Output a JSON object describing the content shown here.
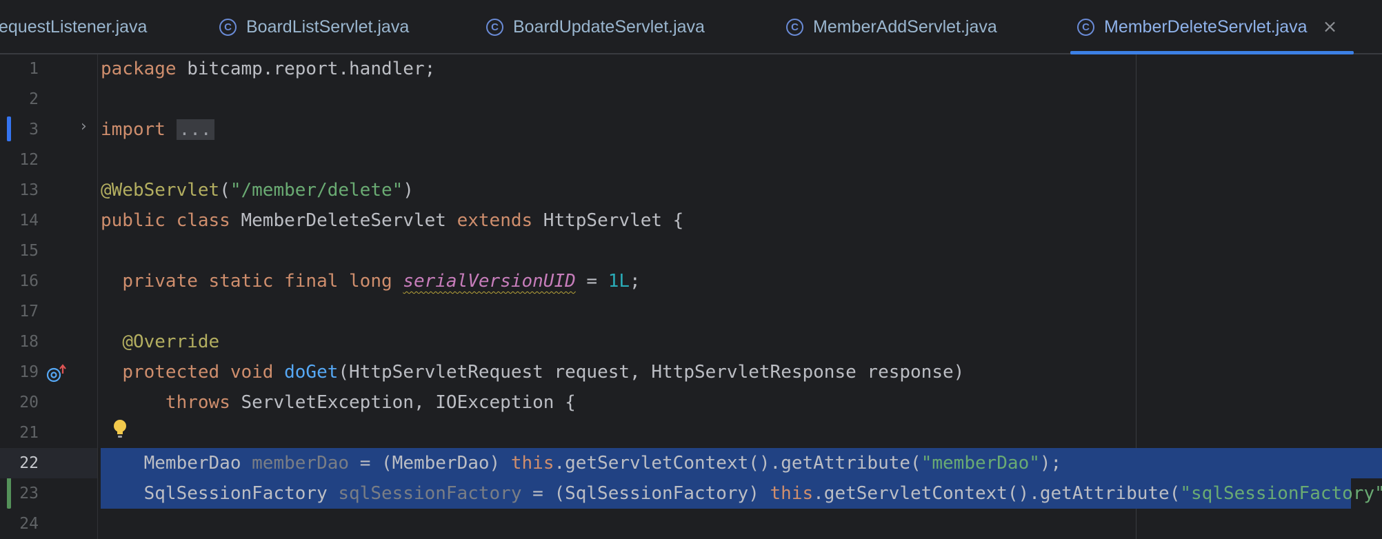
{
  "tabs": [
    {
      "label": "equestListener.java",
      "active": false
    },
    {
      "label": "BoardListServlet.java",
      "active": false
    },
    {
      "label": "BoardUpdateServlet.java",
      "active": false
    },
    {
      "label": "MemberAddServlet.java",
      "active": false
    },
    {
      "label": "MemberDeleteServlet.java",
      "active": true
    }
  ],
  "tab_icon_glyph": "C",
  "tab_close_glyph": "×",
  "colors": {
    "background": "#1e1f22",
    "selection": "#214283",
    "keyword": "#cf8e6d",
    "string": "#6aab73",
    "annotation": "#b3ae60",
    "number": "#2aacb8",
    "method": "#56a8f5",
    "constant": "#c77dbb",
    "active_tab_underline": "#3c80e6"
  },
  "editor": {
    "current_line": "22",
    "lines": [
      {
        "num": "1",
        "tokens": [
          [
            "kw",
            "package"
          ],
          [
            "txt",
            " bitcamp.report.handler;"
          ]
        ]
      },
      {
        "num": "2",
        "tokens": []
      },
      {
        "num": "3",
        "tokens": [
          [
            "kw",
            "import"
          ],
          [
            "txt",
            " "
          ],
          [
            "fold",
            "..."
          ]
        ]
      },
      {
        "num": "12",
        "tokens": []
      },
      {
        "num": "13",
        "tokens": [
          [
            "ann",
            "@WebServlet"
          ],
          [
            "txt",
            "("
          ],
          [
            "str",
            "\"/member/delete\""
          ],
          [
            "txt",
            ")"
          ]
        ]
      },
      {
        "num": "14",
        "tokens": [
          [
            "kw",
            "public class"
          ],
          [
            "txt",
            " MemberDeleteServlet "
          ],
          [
            "kw",
            "extends"
          ],
          [
            "txt",
            " HttpServlet {"
          ]
        ]
      },
      {
        "num": "15",
        "tokens": []
      },
      {
        "num": "16",
        "tokens": [
          [
            "txt",
            "  "
          ],
          [
            "kw",
            "private static final long"
          ],
          [
            "txt",
            " "
          ],
          [
            "const",
            "serialVersionUID"
          ],
          [
            "txt",
            " = "
          ],
          [
            "num",
            "1L"
          ],
          [
            "txt",
            ";"
          ]
        ]
      },
      {
        "num": "17",
        "tokens": []
      },
      {
        "num": "18",
        "tokens": [
          [
            "txt",
            "  "
          ],
          [
            "ann",
            "@Override"
          ]
        ]
      },
      {
        "num": "19",
        "tokens": [
          [
            "txt",
            "  "
          ],
          [
            "kw",
            "protected void"
          ],
          [
            "txt",
            " "
          ],
          [
            "fn",
            "doGet"
          ],
          [
            "txt",
            "(HttpServletRequest request, HttpServletResponse response)"
          ]
        ]
      },
      {
        "num": "20",
        "tokens": [
          [
            "txt",
            "      "
          ],
          [
            "kw",
            "throws"
          ],
          [
            "txt",
            " ServletException, IOException {"
          ]
        ]
      },
      {
        "num": "21",
        "tokens": []
      },
      {
        "num": "22",
        "tokens": [
          [
            "txt",
            "    MemberDao "
          ],
          [
            "unused",
            "memberDao"
          ],
          [
            "txt",
            " = (MemberDao) "
          ],
          [
            "kw",
            "this"
          ],
          [
            "txt",
            ".getServletContext().getAttribute("
          ],
          [
            "str",
            "\"memberDao\""
          ],
          [
            "txt",
            ");"
          ]
        ]
      },
      {
        "num": "23",
        "tokens": [
          [
            "txt",
            "    SqlSessionFactory "
          ],
          [
            "unused",
            "sqlSessionFactory"
          ],
          [
            "txt",
            " = (SqlSessionFactory) "
          ],
          [
            "kw",
            "this"
          ],
          [
            "txt",
            ".getServletContext().getAttribute("
          ],
          [
            "str",
            "\"sqlSessionFactory\""
          ],
          [
            "txt",
            ");"
          ]
        ]
      },
      {
        "num": "24",
        "tokens": []
      }
    ]
  }
}
